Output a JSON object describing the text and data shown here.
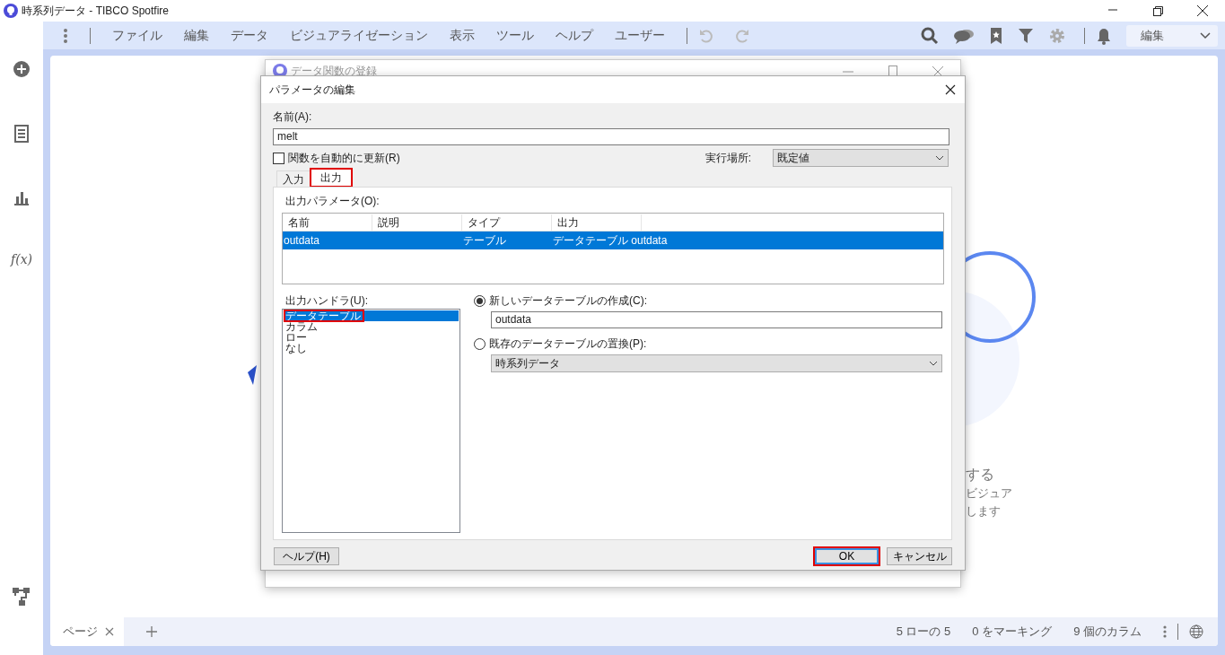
{
  "window": {
    "title": "時系列データ - TIBCO Spotfire"
  },
  "menu": [
    "ファイル",
    "編集",
    "データ",
    "ビジュアライゼーション",
    "表示",
    "ツール",
    "ヘルプ",
    "ユーザー"
  ],
  "mode_select": {
    "value": "編集"
  },
  "sidebar": {
    "function_label": "f(x)"
  },
  "background_text": [
    "する",
    "ビジュア",
    "します"
  ],
  "back_dialog": {
    "title": "データ関数の登録"
  },
  "dialog": {
    "title": "パラメータの編集",
    "name_label": "名前(A):",
    "name_value": "melt",
    "auto_update": {
      "label": "関数を自動的に更新(R)",
      "checked": false
    },
    "run_location": {
      "label": "実行場所:",
      "value": "既定値"
    },
    "tabs": [
      {
        "label": "入力",
        "selected": false,
        "highlighted": false
      },
      {
        "label": "出力",
        "selected": true,
        "highlighted": true
      }
    ],
    "output_parameters": {
      "label": "出力パラメータ(O):",
      "columns": [
        "名前",
        "説明",
        "タイプ",
        "出力"
      ],
      "rows": [
        {
          "name": "outdata",
          "type": "テーブル",
          "output": "データテーブル outdata",
          "selected": true
        }
      ]
    },
    "output_handler": {
      "label": "出力ハンドラ(U):",
      "items": [
        {
          "label": "データテーブル",
          "selected": true,
          "highlighted": true
        },
        {
          "label": "カラム",
          "selected": false,
          "highlighted": false
        },
        {
          "label": "ロー",
          "selected": false,
          "highlighted": false
        },
        {
          "label": "なし",
          "selected": false,
          "highlighted": false
        }
      ]
    },
    "options": [
      {
        "kind": "input",
        "label": "新しいデータテーブルの作成(C):",
        "selected": true,
        "value": "outdata"
      },
      {
        "kind": "select",
        "label": "既存のデータテーブルの置換(P):",
        "selected": false,
        "value": "時系列データ"
      }
    ],
    "buttons": [
      {
        "label": "ヘルプ(H)",
        "highlighted": false
      },
      {
        "label": "OK",
        "highlighted": true
      },
      {
        "label": "キャンセル",
        "highlighted": false
      }
    ]
  },
  "status_bar": {
    "page_tab": "ページ",
    "items": [
      "5 ローの 5",
      "0 をマーキング",
      "9 個のカラム"
    ]
  }
}
